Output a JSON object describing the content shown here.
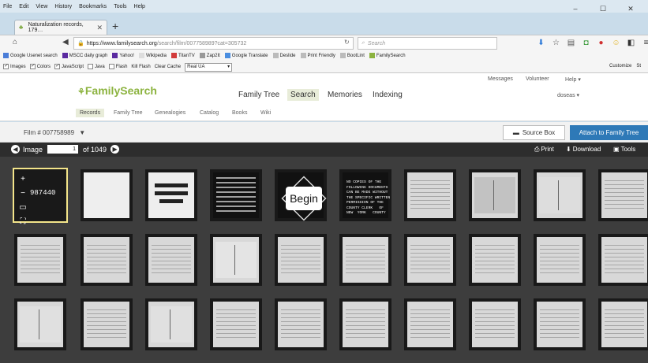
{
  "menubar": {
    "items": [
      "File",
      "Edit",
      "View",
      "History",
      "Bookmarks",
      "Tools",
      "Help"
    ]
  },
  "window_controls": {
    "minimize": "–",
    "maximize": "☐",
    "close": "✕"
  },
  "tab": {
    "title": "Naturalization records, 179…",
    "close": "✕",
    "new_tab": "+"
  },
  "navbar": {
    "url_host": "https://www.familysearch.org",
    "url_path": "/search/film/007758989?cat=305732",
    "search_placeholder": "Search"
  },
  "bookmarks": [
    "Google Usenet search",
    "MSCC daily graph",
    "Yahoo!",
    "Wikipedia",
    "TitanTV",
    "Zap2It",
    "Google Translate",
    "Deslide",
    "Print Friendly",
    "BootLint",
    "FamilySearch"
  ],
  "devbar": {
    "items": [
      "Images",
      "Colors",
      "JavaScript",
      "Java",
      "Flash"
    ],
    "checked": [
      true,
      true,
      true,
      false,
      false
    ],
    "kill_flash": "Kill Flash",
    "clear_cache": "Clear Cache",
    "ua_value": "Real UA",
    "customize": "Customize",
    "st": "St"
  },
  "header": {
    "messages": "Messages",
    "volunteer": "Volunteer",
    "help": "Help ▾",
    "user": "doseas ▾",
    "logo": "FamilySearch",
    "nav": [
      "Family Tree",
      "Search",
      "Memories",
      "Indexing"
    ],
    "active_nav": "Search"
  },
  "subnav": {
    "items": [
      "Records",
      "Family Tree",
      "Genealogies",
      "Catalog",
      "Books",
      "Wiki"
    ],
    "active": "Records"
  },
  "filmbar": {
    "film_label": "Film # 007758989",
    "source_box": "Source Box",
    "attach": "Attach to Family Tree"
  },
  "viewer": {
    "image_label": "Image",
    "image_value": "1",
    "of_total": "of 1049",
    "print": "Print",
    "download": "Download",
    "tools": "Tools"
  },
  "thumbs": {
    "film_number": "987440",
    "begin": "Begin",
    "notice": "NO COPIES OF THE\nFOLLOWING DOCUMENTS\nCAN BE MADE WITHOUT\nTHE SPECIFIC WRITTEN\nPERMISSION OF THE\nCOUNTY CLERK   OF\nNEW  YORK   COUNTY"
  },
  "colors": {
    "accent": "#2e79b7",
    "logo_green": "#8cb33f",
    "viewer_bg": "#3d3d3d"
  }
}
